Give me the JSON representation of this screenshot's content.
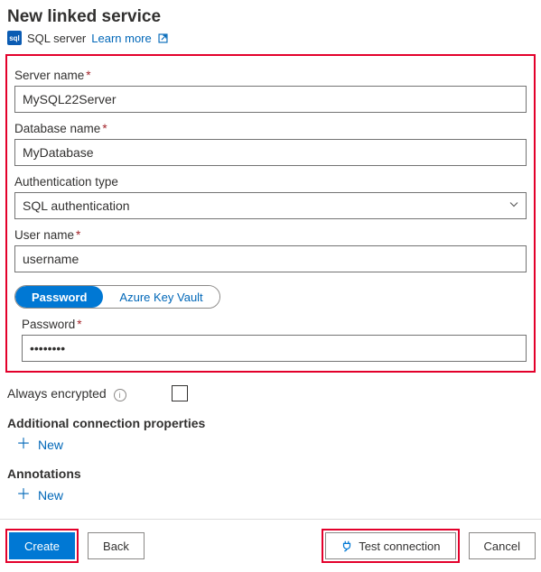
{
  "header": {
    "title": "New linked service",
    "service_type": "SQL server",
    "learn_more": "Learn more"
  },
  "form": {
    "server_name": {
      "label": "Server name",
      "value": "MySQL22Server"
    },
    "database_name": {
      "label": "Database name",
      "value": "MyDatabase"
    },
    "auth_type": {
      "label": "Authentication type",
      "value": "SQL authentication"
    },
    "user_name": {
      "label": "User name",
      "value": "username"
    },
    "password_toggle": {
      "password_tab": "Password",
      "akv_tab": "Azure Key Vault"
    },
    "password": {
      "label": "Password",
      "value": "••••••••"
    }
  },
  "options": {
    "always_encrypted": "Always encrypted",
    "additional_props": "Additional connection properties",
    "annotations": "Annotations",
    "new_label": "New"
  },
  "footer": {
    "create": "Create",
    "back": "Back",
    "test": "Test connection",
    "cancel": "Cancel"
  }
}
